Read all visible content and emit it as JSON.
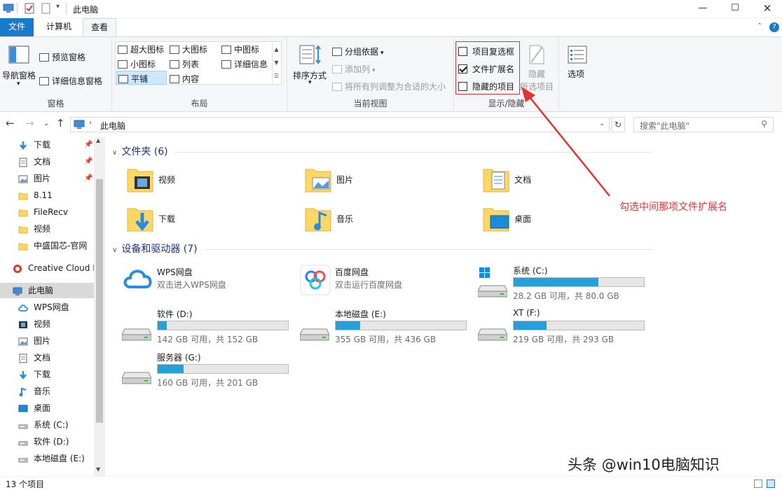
{
  "window": {
    "title": "此电脑"
  },
  "tabs": {
    "file": "文件",
    "computer": "计算机",
    "view": "查看"
  },
  "ribbon": {
    "pane": {
      "nav_pane": "导航窗格",
      "preview_pane": "预览窗格",
      "details_pane": "详细信息窗格",
      "group": "窗格"
    },
    "layout": {
      "xl": "超大图标",
      "large": "大图标",
      "medium": "中图标",
      "small": "小图标",
      "list": "列表",
      "details": "详细信息",
      "tiles": "平铺",
      "content": "内容",
      "group": "布局"
    },
    "current_view": {
      "sort": "排序方式",
      "group_by": "分组依据",
      "add_col": "添加列",
      "fit_cols": "将所有列调整为合适的大小",
      "group": "当前视图"
    },
    "show_hide": {
      "item_checkbox": "项目复选框",
      "extensions": "文件扩展名",
      "hidden_items": "隐藏的项目",
      "hide_selected_1": "隐藏",
      "hide_selected_2": "所选项目",
      "group": "显示/隐藏",
      "extensions_checked": true,
      "item_checkbox_checked": false,
      "hidden_checked": false
    },
    "options": "选项"
  },
  "address": {
    "path": "此电脑",
    "search_placeholder": "搜索\"此电脑\""
  },
  "sidebar": {
    "items": [
      {
        "label": "下载",
        "icon": "download-arrow-icon",
        "pinned": true
      },
      {
        "label": "文档",
        "icon": "document-icon",
        "pinned": true
      },
      {
        "label": "图片",
        "icon": "picture-icon",
        "pinned": true
      },
      {
        "label": "8.11",
        "icon": "folder-icon"
      },
      {
        "label": "FileRecv",
        "icon": "folder-icon"
      },
      {
        "label": "视频",
        "icon": "folder-icon"
      },
      {
        "label": "中盛国芯-官网",
        "icon": "folder-icon"
      },
      {
        "label": "Creative Cloud F",
        "icon": "creative-cloud-icon"
      },
      {
        "label": "此电脑",
        "icon": "computer-icon",
        "selected": true
      },
      {
        "label": "WPS网盘",
        "icon": "cloud-icon"
      },
      {
        "label": "视频",
        "icon": "video-icon"
      },
      {
        "label": "图片",
        "icon": "picture-icon"
      },
      {
        "label": "文档",
        "icon": "document-icon"
      },
      {
        "label": "下载",
        "icon": "download-arrow-icon"
      },
      {
        "label": "音乐",
        "icon": "music-icon"
      },
      {
        "label": "桌面",
        "icon": "desktop-icon"
      },
      {
        "label": "系统 (C:)",
        "icon": "drive-icon"
      },
      {
        "label": "软件 (D:)",
        "icon": "drive-icon"
      },
      {
        "label": "本地磁盘 (E:)",
        "icon": "drive-icon"
      }
    ]
  },
  "folders_section": {
    "title": "文件夹 (6)",
    "items": [
      "视频",
      "图片",
      "文档",
      "下载",
      "音乐",
      "桌面"
    ]
  },
  "drives_section": {
    "title": "设备和驱动器 (7)",
    "wps": {
      "name": "WPS网盘",
      "sub": "双击进入WPS网盘"
    },
    "baidu": {
      "name": "百度网盘",
      "sub": "双击运行百度网盘"
    },
    "drives": [
      {
        "name": "系统 (C:)",
        "info": "28.2 GB 可用，共 80.0 GB",
        "used_fraction": 0.65
      },
      {
        "name": "软件 (D:)",
        "info": "142 GB 可用，共 152 GB",
        "used_fraction": 0.07
      },
      {
        "name": "本地磁盘 (E:)",
        "info": "355 GB 可用，共 436 GB",
        "used_fraction": 0.19
      },
      {
        "name": "XT (F:)",
        "info": "219 GB 可用，共 293 GB",
        "used_fraction": 0.25
      },
      {
        "name": "服务器 (G:)",
        "info": "160 GB 可用，共 201 GB",
        "used_fraction": 0.2
      }
    ]
  },
  "annotation": {
    "text": "勾选中间那项文件扩展名"
  },
  "status": {
    "count": "13 个项目"
  },
  "watermark": "头条 @win10电脑知识",
  "colors": {
    "accent": "#1979ca",
    "bar": "#26a0da",
    "annotation": "#e53333"
  }
}
